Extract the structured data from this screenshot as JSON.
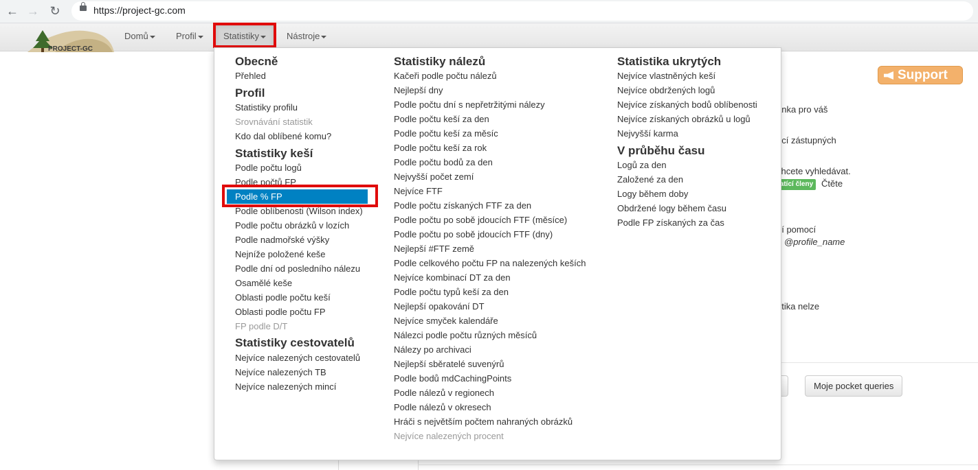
{
  "browser": {
    "back_icon": "back-arrow-icon",
    "forward_icon": "forward-arrow-icon",
    "reload_icon": "reload-icon",
    "url": "https://project-gc.com"
  },
  "navbar": {
    "logo_text": "PROJECT-GC",
    "items": [
      {
        "label": "Domů"
      },
      {
        "label": "Profil"
      },
      {
        "label": "Statistiky"
      },
      {
        "label": "Nástroje"
      }
    ]
  },
  "background": {
    "support_label": "Support",
    "snippets": [
      "ánka pro váš",
      "ocí zástupných",
      "chcete vyhledávat.",
      "Čtěte",
      "ní pomocí",
      "@profile_name",
      "ritika nelze"
    ],
    "badge": "latící členy",
    "pocket_button": "Moje pocket queries"
  },
  "menu": {
    "col1": {
      "sections": [
        {
          "heading": "Obecně",
          "items": [
            {
              "label": "Přehled"
            }
          ]
        },
        {
          "heading": "Profil",
          "items": [
            {
              "label": "Statistiky profilu"
            },
            {
              "label": "Srovnávání statistik",
              "disabled": true
            },
            {
              "label": "Kdo dal oblíbené komu?"
            }
          ]
        },
        {
          "heading": "Statistiky keší",
          "items": [
            {
              "label": "Podle počtu logů"
            },
            {
              "label": "Podle počtů FP"
            },
            {
              "label": "Podle % FP",
              "active": true
            },
            {
              "label": "Podle oblíbenosti (Wilson index)"
            },
            {
              "label": "Podle počtu obrázků v lozích"
            },
            {
              "label": "Podle nadmořské výšky"
            },
            {
              "label": "Nejníže položené keše"
            },
            {
              "label": "Podle dní od posledního nálezu"
            },
            {
              "label": "Osamělé keše"
            },
            {
              "label": "Oblasti podle počtu keší"
            },
            {
              "label": "Oblasti podle počtu FP"
            },
            {
              "label": "FP podle D/T",
              "disabled": true
            }
          ]
        },
        {
          "heading": "Statistiky cestovatelů",
          "items": [
            {
              "label": "Nejvíce nalezených cestovatelů"
            },
            {
              "label": "Nejvíce nalezených TB"
            },
            {
              "label": "Nejvíce nalezených mincí"
            }
          ]
        }
      ]
    },
    "col2": {
      "sections": [
        {
          "heading": "Statistiky nálezů",
          "items": [
            {
              "label": "Kačeři podle počtu nálezů"
            },
            {
              "label": "Nejlepší dny"
            },
            {
              "label": "Podle počtu dní s nepřetržitými nálezy"
            },
            {
              "label": "Podle počtu keší za den"
            },
            {
              "label": "Podle počtu keší za měsíc"
            },
            {
              "label": "Podle počtu keší za rok"
            },
            {
              "label": "Podle počtu bodů za den"
            },
            {
              "label": "Nejvyšší počet zemí"
            },
            {
              "label": "Nejvíce FTF"
            },
            {
              "label": "Podle počtu získaných FTF za den"
            },
            {
              "label": "Podle počtu po sobě jdoucích FTF (měsíce)"
            },
            {
              "label": "Podle počtu po sobě jdoucích FTF (dny)"
            },
            {
              "label": "Nejlepší #FTF země"
            },
            {
              "label": "Podle celkového počtu FP na nalezených keších"
            },
            {
              "label": "Nejvíce kombinací DT za den"
            },
            {
              "label": "Podle počtu typů keší za den"
            },
            {
              "label": "Nejlepší opakování DT"
            },
            {
              "label": "Nejvíce smyček kalendáře"
            },
            {
              "label": "Nálezci podle počtu různých měsíců"
            },
            {
              "label": "Nálezy po archivaci"
            },
            {
              "label": "Nejlepší sběratelé suvenýrů"
            },
            {
              "label": "Podle bodů mdCachingPoints"
            },
            {
              "label": "Podle nálezů v regionech"
            },
            {
              "label": "Podle nálezů v okresech"
            },
            {
              "label": "Hráči s největším počtem nahraných obrázků"
            },
            {
              "label": "Nejvíce nalezených procent",
              "disabled": true
            }
          ]
        }
      ]
    },
    "col3": {
      "sections": [
        {
          "heading": "Statistika ukrytých",
          "items": [
            {
              "label": "Nejvíce vlastněných keší"
            },
            {
              "label": "Nejvíce obdržených logů"
            },
            {
              "label": "Nejvíce získaných bodů oblíbenosti"
            },
            {
              "label": "Nejvíce získaných obrázků u logů"
            },
            {
              "label": "Nejvyšší karma"
            }
          ]
        },
        {
          "heading": "V průběhu času",
          "items": [
            {
              "label": "Logů za den"
            },
            {
              "label": "Založené za den"
            },
            {
              "label": "Logy během doby"
            },
            {
              "label": "Obdržené logy během času"
            },
            {
              "label": "Podle FP získaných za čas"
            }
          ]
        }
      ]
    }
  }
}
